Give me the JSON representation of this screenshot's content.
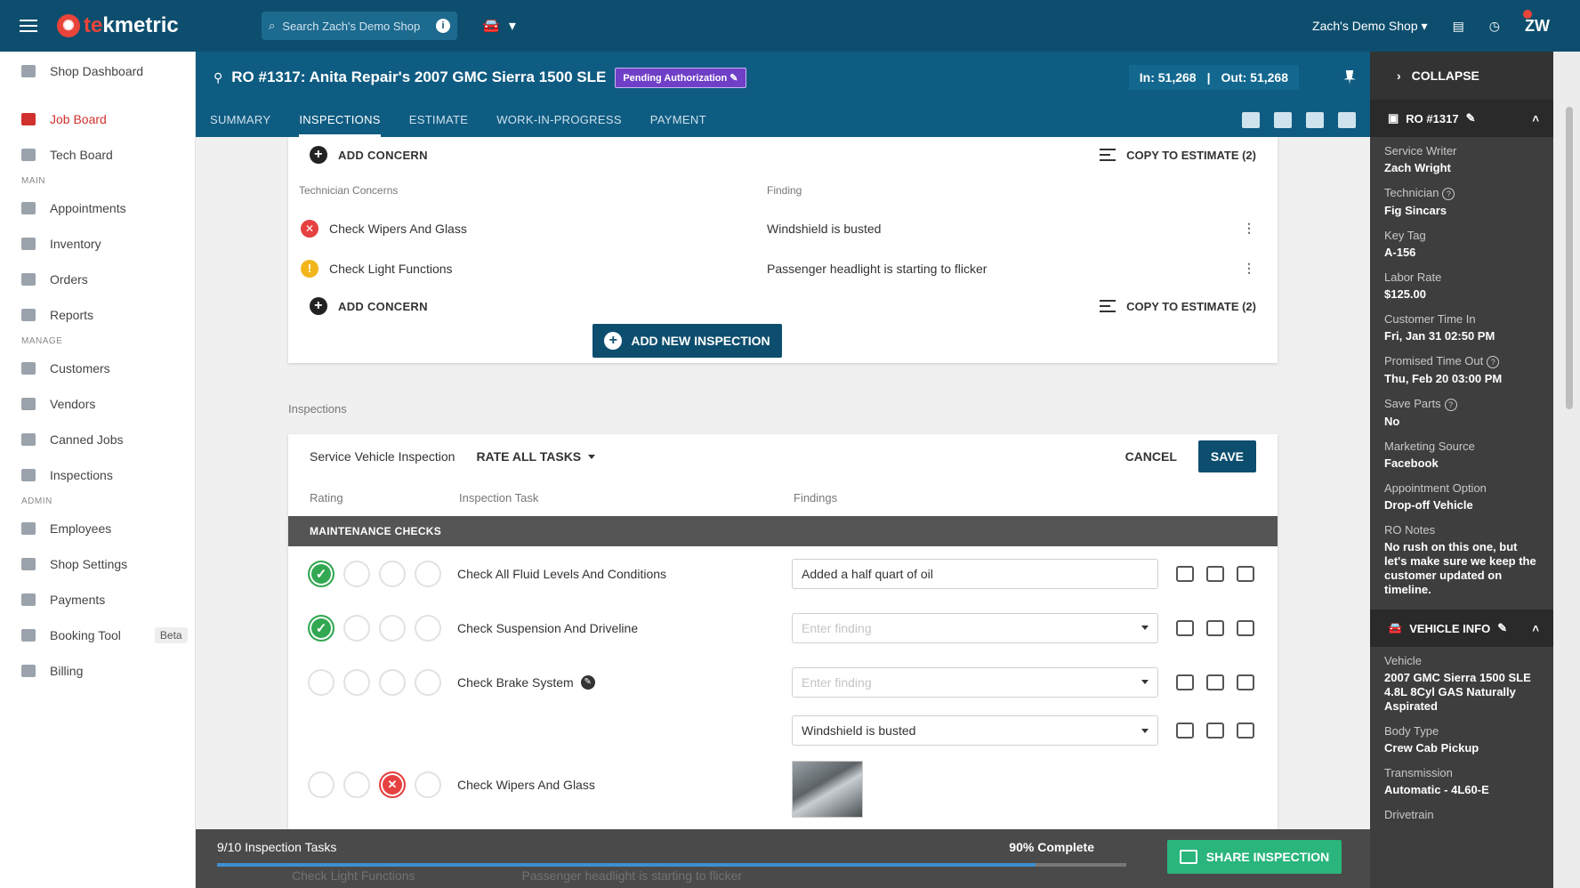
{
  "topbar": {
    "logo_text": "tekmetric",
    "search_placeholder": "Search Zach's Demo Shop",
    "search_info": "i",
    "shop_name": "Zach's Demo Shop",
    "user_initials": "ZW"
  },
  "sidebar": {
    "items_top": [
      {
        "label": "Shop Dashboard",
        "icon": "dashboard-icon"
      },
      {
        "label": "Job Board",
        "icon": "job-board-icon",
        "active": true
      },
      {
        "label": "Tech Board",
        "icon": "tech-board-icon"
      }
    ],
    "section_main": "MAIN",
    "items_main": [
      {
        "label": "Appointments",
        "icon": "calendar-icon"
      },
      {
        "label": "Inventory",
        "icon": "inventory-icon"
      },
      {
        "label": "Orders",
        "icon": "orders-icon"
      },
      {
        "label": "Reports",
        "icon": "reports-icon"
      }
    ],
    "section_manage": "MANAGE",
    "items_manage": [
      {
        "label": "Customers",
        "icon": "customers-icon"
      },
      {
        "label": "Vendors",
        "icon": "vendors-icon"
      },
      {
        "label": "Canned Jobs",
        "icon": "star-icon"
      },
      {
        "label": "Inspections",
        "icon": "inspections-icon"
      }
    ],
    "section_admin": "ADMIN",
    "items_admin": [
      {
        "label": "Employees",
        "icon": "employees-icon"
      },
      {
        "label": "Shop Settings",
        "icon": "gear-icon"
      },
      {
        "label": "Payments",
        "icon": "payments-icon"
      },
      {
        "label": "Booking Tool",
        "icon": "booking-icon",
        "badge": "Beta"
      },
      {
        "label": "Billing",
        "icon": "billing-icon"
      }
    ]
  },
  "ro": {
    "title": "RO #1317: Anita Repair's 2007 GMC Sierra 1500 SLE",
    "status": "Pending Authorization",
    "mileage_in": "In: 51,268",
    "mileage_out": "Out: 51,268",
    "tabs": [
      "SUMMARY",
      "INSPECTIONS",
      "ESTIMATE",
      "WORK-IN-PROGRESS",
      "PAYMENT"
    ],
    "active_tab": "INSPECTIONS"
  },
  "concerns": {
    "add_concern": "ADD CONCERN",
    "copy_to_estimate": "COPY TO ESTIMATE (2)",
    "col_concern": "Technician Concerns",
    "col_finding": "Finding",
    "rows": [
      {
        "name": "Check Wipers And Glass",
        "finding": "Windshield is busted",
        "status": "red"
      },
      {
        "name": "Check Light Functions",
        "finding": "Passenger headlight is starting to flicker",
        "status": "yellow"
      }
    ],
    "add_new_inspection": "ADD NEW INSPECTION"
  },
  "inspections": {
    "section_label": "Inspections",
    "name": "Service Vehicle Inspection",
    "rate_all": "RATE ALL TASKS",
    "cancel": "CANCEL",
    "save": "SAVE",
    "col_rating": "Rating",
    "col_task": "Inspection Task",
    "col_findings": "Findings",
    "group": "MAINTENANCE CHECKS",
    "tasks": [
      {
        "name": "Check All Fluid Levels And Conditions",
        "finding": "Added a half quart of oil",
        "rating": "good"
      },
      {
        "name": "Check Suspension And Driveline",
        "finding_placeholder": "Enter finding",
        "rating": "good"
      },
      {
        "name": "Check Brake System",
        "finding_placeholder": "Enter finding",
        "rating": "none"
      },
      {
        "name": "Check Wipers And Glass",
        "finding": "Windshield is busted",
        "rating": "bad"
      }
    ],
    "ghost_task": "Check Light Functions",
    "ghost_finding": "Passenger headlight is starting to flicker"
  },
  "progress": {
    "tasks_label": "9/10 Inspection Tasks",
    "percent_label": "90% Complete",
    "fraction": 0.9,
    "share": "SHARE INSPECTION"
  },
  "right_panel": {
    "collapse": "COLLAPSE",
    "ro_header": "RO #1317",
    "fields": [
      {
        "label": "Service Writer",
        "value": "Zach Wright"
      },
      {
        "label": "Technician",
        "value": "Fig Sincars",
        "help": true
      },
      {
        "label": "Key Tag",
        "value": "A-156"
      },
      {
        "label": "Labor Rate",
        "value": "$125.00"
      },
      {
        "label": "Customer Time In",
        "value": "Fri, Jan 31 02:50 PM"
      },
      {
        "label": "Promised Time Out",
        "value": "Thu, Feb 20 03:00 PM",
        "help": true
      },
      {
        "label": "Save Parts",
        "value": "No",
        "help": true
      },
      {
        "label": "Marketing Source",
        "value": "Facebook"
      },
      {
        "label": "Appointment Option",
        "value": "Drop-off Vehicle"
      },
      {
        "label": "RO Notes",
        "value": "No rush on this one, but let's make sure we keep the customer updated on timeline."
      }
    ],
    "vehicle_header": "VEHICLE INFO",
    "vehicle_fields": [
      {
        "label": "Vehicle",
        "value": "2007 GMC Sierra 1500 SLE 4.8L 8Cyl GAS Naturally Aspirated"
      },
      {
        "label": "Body Type",
        "value": "Crew Cab Pickup"
      },
      {
        "label": "Transmission",
        "value": "Automatic - 4L60-E"
      },
      {
        "label": "Drivetrain",
        "value": ""
      }
    ]
  },
  "colors": {
    "primary": "#0d4e6e",
    "accent_red": "#e64141",
    "success": "#2ab57d",
    "warning": "#f2b51c"
  }
}
